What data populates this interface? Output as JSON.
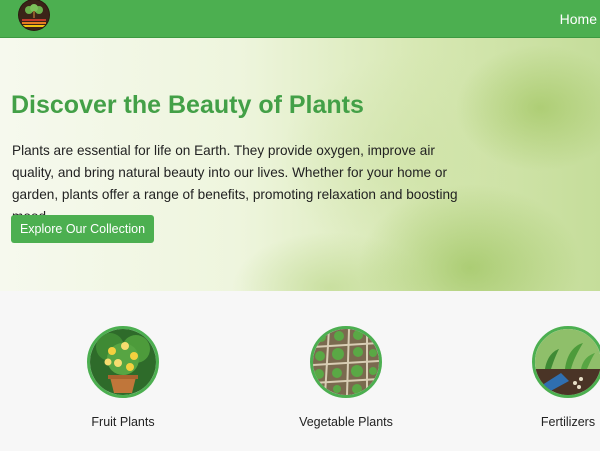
{
  "header": {
    "logo_icon": "plant-logo",
    "nav_home": "Home",
    "color": "#4caf50"
  },
  "hero": {
    "title": "Discover the Beauty of Plants",
    "description": "Plants are essential for life on Earth. They provide oxygen, improve air quality, and bring natural beauty into our lives. Whether for your home or garden, plants offer a range of benefits, promoting relaxation and boosting mood.",
    "cta_label": "Explore Our Collection"
  },
  "categories": [
    {
      "label": "Fruit Plants",
      "icon": "fruit-plant-image"
    },
    {
      "label": "Vegetable Plants",
      "icon": "vegetable-garden-image"
    },
    {
      "label": "Fertilizers",
      "icon": "fertilizer-image"
    }
  ]
}
